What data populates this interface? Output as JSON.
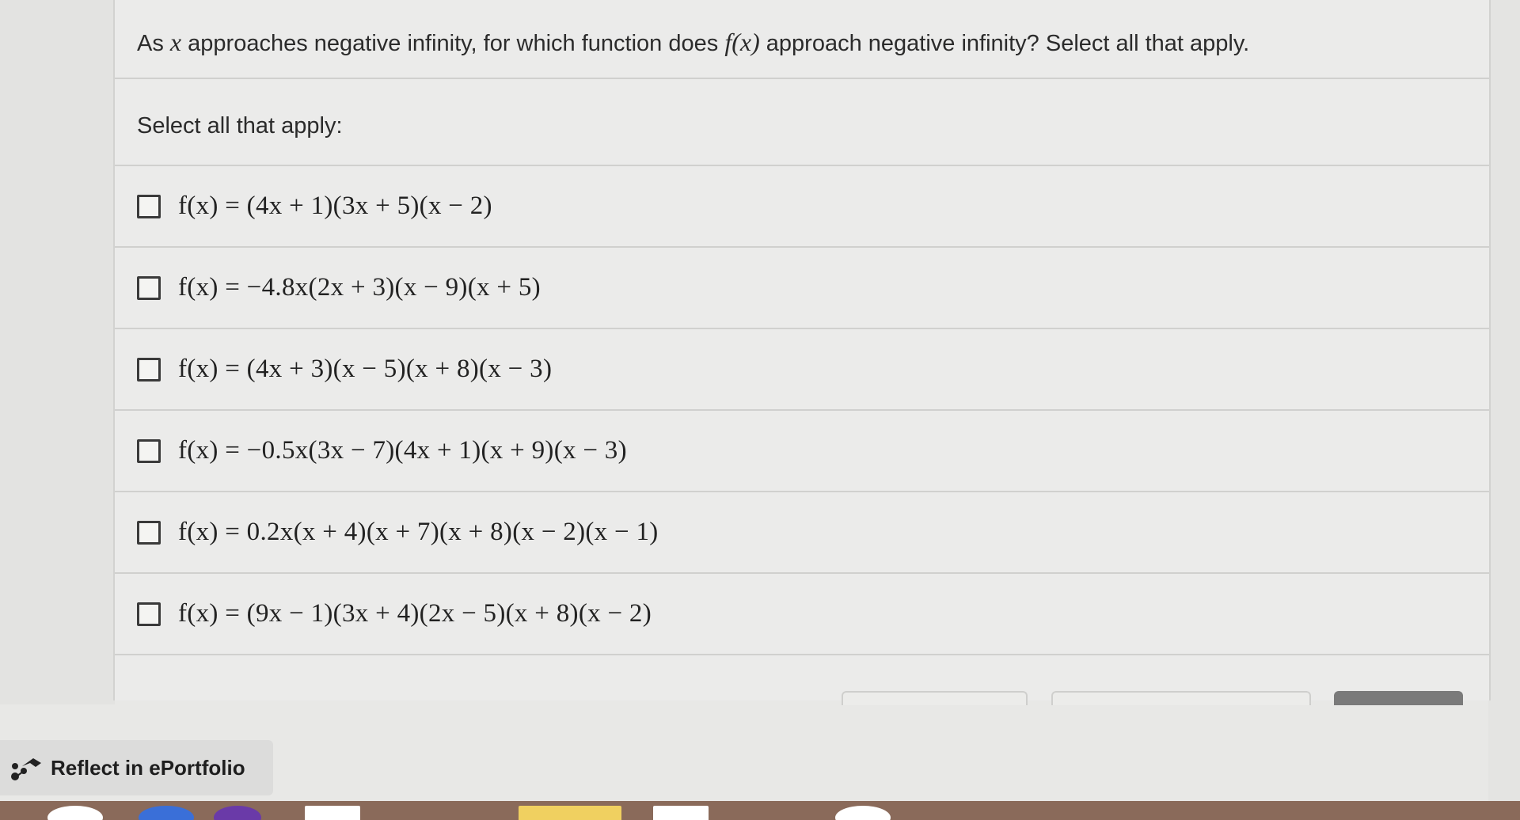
{
  "question": {
    "prefix": "As ",
    "var": "x",
    "middle": " approaches negative infinity, for which function does ",
    "func": "f(x)",
    "suffix": " approach negative infinity? Select all that apply."
  },
  "instruction": "Select all that apply:",
  "options": [
    {
      "label": "f(x) = (4x + 1)(3x + 5)(x − 2)",
      "checked": false
    },
    {
      "label": "f(x) = −4.8x(2x + 3)(x − 9)(x + 5)",
      "checked": false
    },
    {
      "label": "f(x) = (4x + 3)(x − 5)(x + 8)(x − 3)",
      "checked": false
    },
    {
      "label": "f(x) = −0.5x(3x − 7)(4x + 1)(x + 9)(x − 3)",
      "checked": false
    },
    {
      "label": "f(x) = 0.2x(x + 4)(x + 7)(x + 8)(x − 2)(x − 1)",
      "checked": false
    },
    {
      "label": "f(x) = (9x − 1)(3x + 4)(2x − 5)(x + 8)(x − 2)",
      "checked": false
    }
  ],
  "reflect": {
    "label": "Reflect in ePortfolio",
    "icon": "eportfolio-icon"
  },
  "colors": {
    "panel": "#ebebea",
    "border": "#d0d0ce",
    "text": "#2b2b2b",
    "primary_button": "#7a7a7a"
  }
}
